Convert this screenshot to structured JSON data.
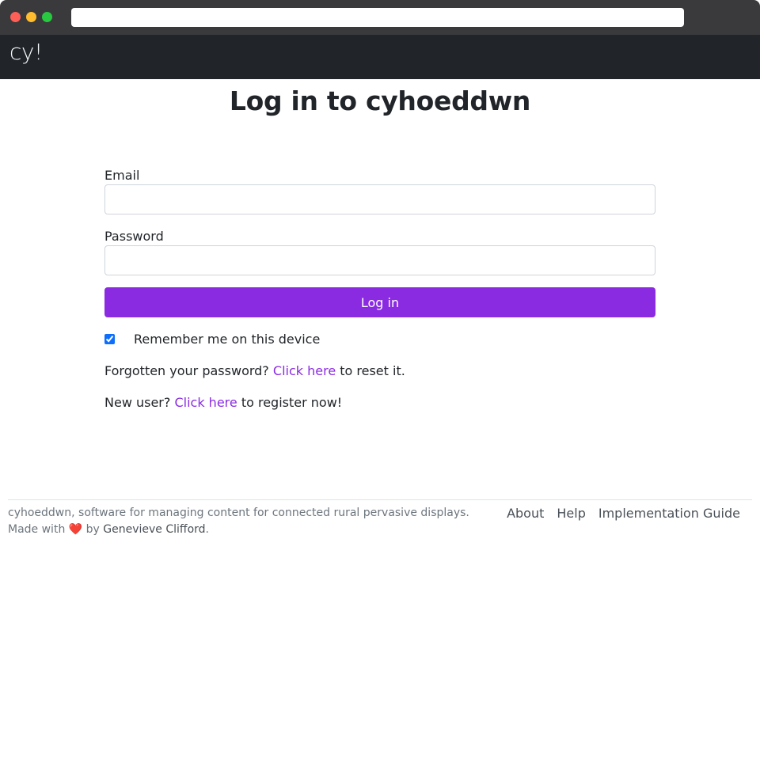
{
  "browser": {
    "url": ""
  },
  "navbar": {
    "brand": "cy!"
  },
  "page": {
    "title": "Log in to cyhoeddwn"
  },
  "form": {
    "email_label": "Email",
    "email_value": "",
    "password_label": "Password",
    "password_value": "",
    "login_button": "Log in",
    "remember_label": "Remember me on this device",
    "remember_checked": true
  },
  "help": {
    "forgot_prefix": "Forgotten your password? ",
    "forgot_link": "Click here",
    "forgot_suffix": " to reset it.",
    "register_prefix": "New user? ",
    "register_link": "Click here",
    "register_suffix": " to register now!"
  },
  "footer": {
    "tagline": "cyhoeddwn, software for managing content for connected rural pervasive displays.",
    "made_with_prefix": "Made with ",
    "heart": "❤️",
    "made_with_by": " by ",
    "author": "Genevieve Clifford",
    "made_with_suffix": ".",
    "links": [
      "About",
      "Help",
      "Implementation Guide"
    ]
  },
  "colors": {
    "accent": "#8a2be2",
    "navbar": "#212529",
    "chrome": "#3a3a3c"
  }
}
